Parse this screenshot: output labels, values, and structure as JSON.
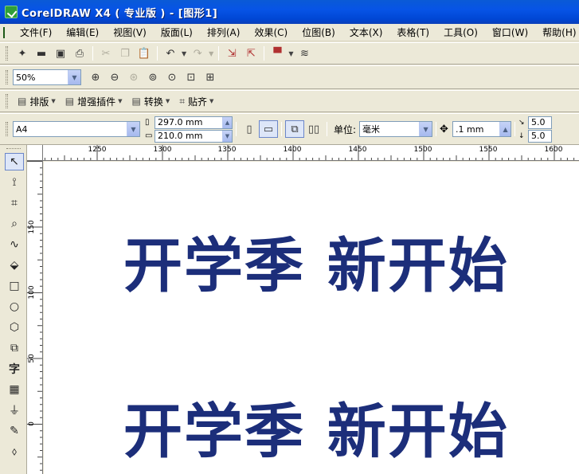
{
  "window": {
    "title": "CorelDRAW X4 ( 专业版 ) - [图形1]"
  },
  "menu": [
    "文件(F)",
    "编辑(E)",
    "视图(V)",
    "版面(L)",
    "排列(A)",
    "效果(C)",
    "位图(B)",
    "文本(X)",
    "表格(T)",
    "工具(O)",
    "窗口(W)",
    "帮助(H)"
  ],
  "standard_toolbar": {
    "icons": [
      "new-icon",
      "open-icon",
      "save-icon",
      "print-icon",
      "cut-icon",
      "copy-icon",
      "paste-icon",
      "undo-icon",
      "redo-icon",
      "import-icon",
      "export-icon",
      "launcher-icon",
      "options-icon"
    ]
  },
  "zoom_toolbar": {
    "zoom_value": "50%",
    "icons": [
      "zoom-in-icon",
      "zoom-out-icon",
      "zoom-selected-icon",
      "zoom-all-icon",
      "zoom-page-icon",
      "zoom-width-icon",
      "zoom-height-icon"
    ]
  },
  "plugin_toolbar": {
    "buttons": [
      "排版",
      "增强插件",
      "转换",
      "贴齐"
    ]
  },
  "property_bar": {
    "paper_size": "A4",
    "width": "297.0 mm",
    "height": "210.0 mm",
    "units_label": "单位:",
    "units_value": "毫米",
    "nudge": ".1 mm",
    "dup_x": "5.0",
    "dup_y": "5.0"
  },
  "ruler_top": {
    "labels": [
      "1250",
      "1300",
      "1350",
      "1400",
      "1450",
      "1500",
      "1550",
      "1600"
    ]
  },
  "ruler_left": {
    "labels": [
      "150",
      "100",
      "50",
      "0"
    ]
  },
  "toolbox": {
    "icons": [
      "pick-tool-icon",
      "shape-tool-icon",
      "crop-tool-icon",
      "zoom-tool-icon",
      "freehand-tool-icon",
      "smart-fill-icon",
      "rectangle-tool-icon",
      "ellipse-tool-icon",
      "polygon-tool-icon",
      "basic-shapes-icon",
      "text-tool-icon",
      "table-tool-icon",
      "interactive-blend-icon",
      "eyedropper-icon",
      "outline-tool-icon"
    ],
    "text_tool_glyph": "字"
  },
  "artwork": {
    "line1": "开学季 新开始",
    "line2": "开学季 新开始",
    "color": "#1c2e7a"
  }
}
